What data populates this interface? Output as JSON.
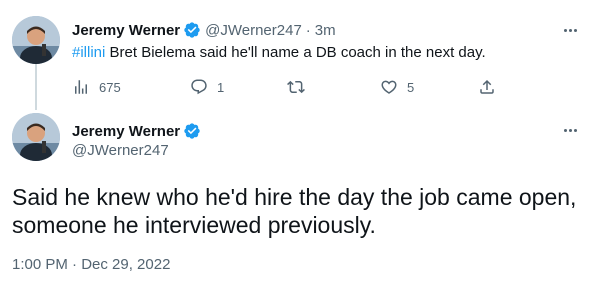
{
  "colors": {
    "accent": "#1d9bf0",
    "text_primary": "#0f1419",
    "text_secondary": "#536471",
    "thread_line": "#cfd9de"
  },
  "tweet1": {
    "author_name": "Jeremy Werner",
    "handle": "@JWerner247",
    "separator": "·",
    "time_ago": "3m",
    "hashtag": "#illini",
    "text": " Bret Bielema said he'll name a DB coach in the next day.",
    "views_count": "675",
    "reply_count": "1",
    "retweet_count": "",
    "like_count": "5",
    "icons": [
      "analytics-icon",
      "reply-icon",
      "retweet-icon",
      "like-icon",
      "share-icon",
      "more-icon",
      "verified-icon"
    ]
  },
  "tweet2": {
    "author_name": "Jeremy Werner",
    "handle": "@JWerner247",
    "text": "Said he knew who he'd hire the day the job came open, someone he interviewed previously.",
    "timestamp": "1:00 PM · Dec 29, 2022"
  }
}
